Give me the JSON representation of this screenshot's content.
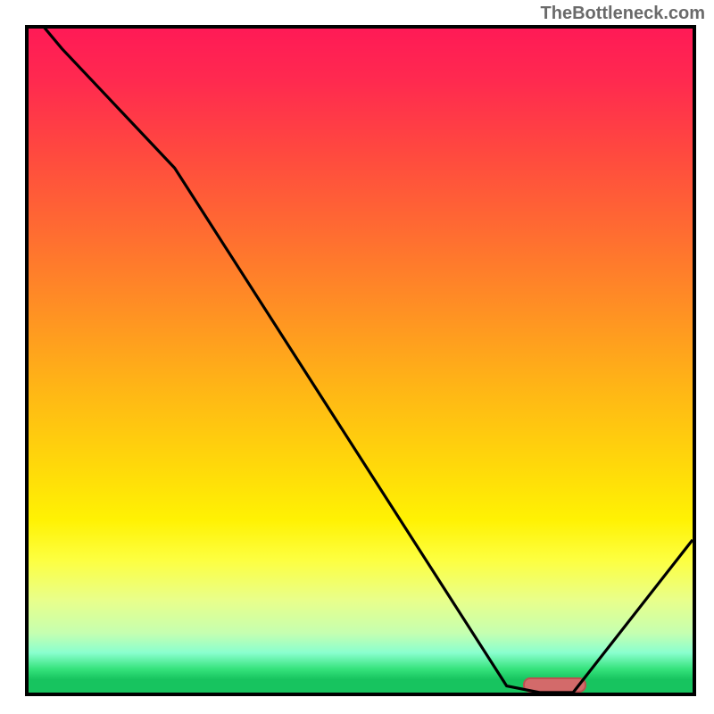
{
  "attribution": "TheBottleneck.com",
  "chart_data": {
    "type": "line",
    "title": "",
    "xlabel": "",
    "ylabel": "",
    "x": [
      0.0,
      0.05,
      0.22,
      0.72,
      0.77,
      0.82,
      1.0
    ],
    "values": [
      1.03,
      0.97,
      0.79,
      0.01,
      0.0,
      0.0,
      0.23
    ],
    "xlim": [
      0,
      1
    ],
    "ylim": [
      0,
      1
    ],
    "marker": {
      "x_start": 0.745,
      "x_end": 0.84,
      "y": 0.012,
      "height": 0.023
    }
  },
  "colors": {
    "frame": "#000000",
    "curve": "#000000",
    "marker_fill": "#d36a6a",
    "marker_border": "#bc5050",
    "attribution": "#6a6a6a"
  }
}
